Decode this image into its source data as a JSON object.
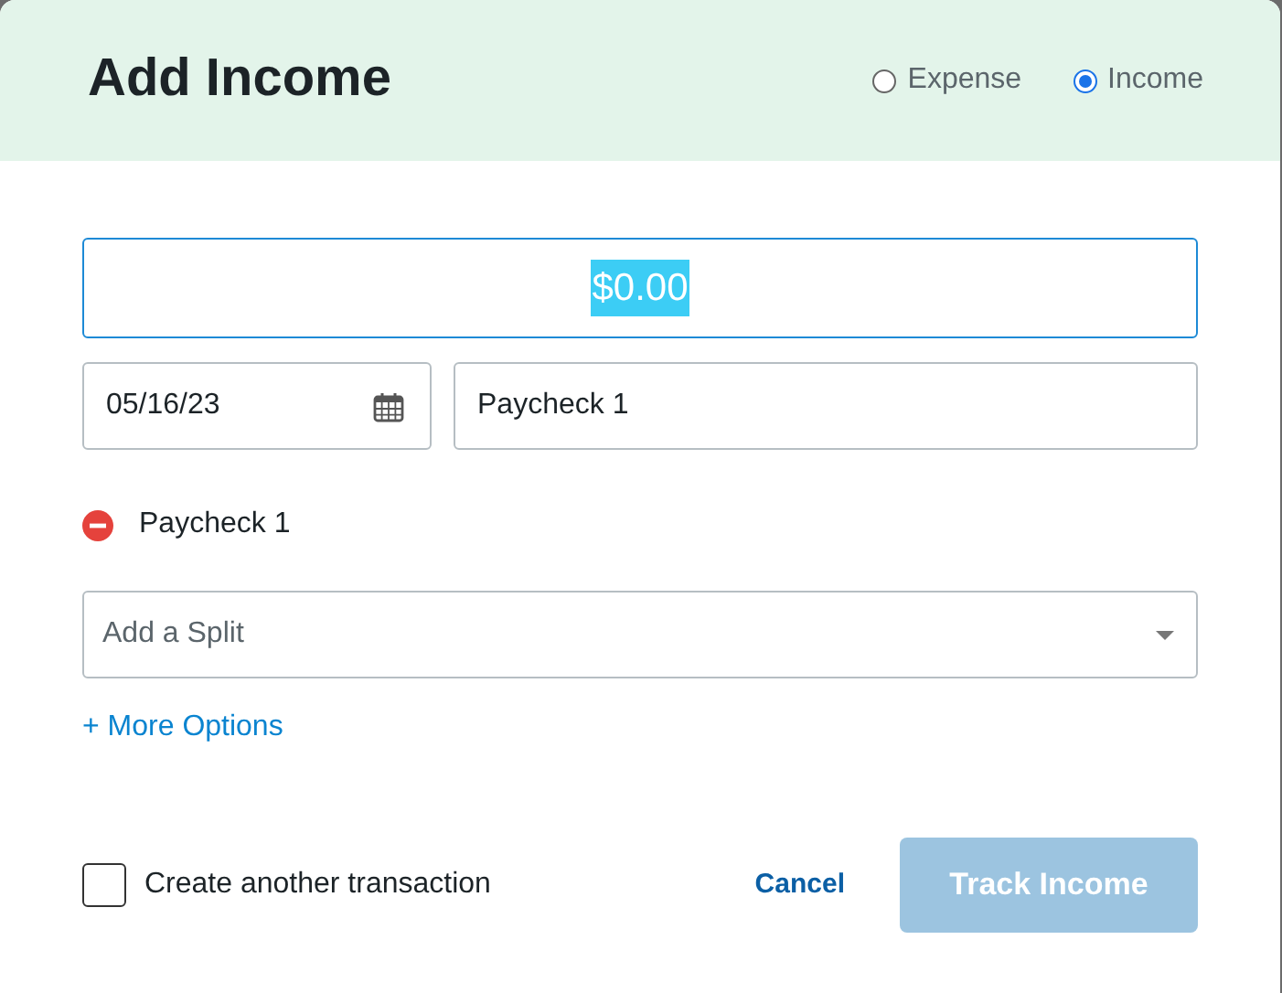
{
  "title": "Add Income",
  "type_options": [
    {
      "label": "Expense",
      "selected": false
    },
    {
      "label": "Income",
      "selected": true
    }
  ],
  "amount": {
    "value": "$0.00",
    "highlighted": true
  },
  "date": {
    "value": "05/16/23"
  },
  "description": {
    "value": "Paycheck 1"
  },
  "splits": [
    {
      "label": "Paycheck 1"
    }
  ],
  "split_field": {
    "placeholder": "Add a Split"
  },
  "more_options": "+ More Options",
  "create_another": {
    "label": "Create another transaction",
    "checked": false
  },
  "cancel": "Cancel",
  "submit": {
    "label": "Track Income",
    "disabled": true
  }
}
